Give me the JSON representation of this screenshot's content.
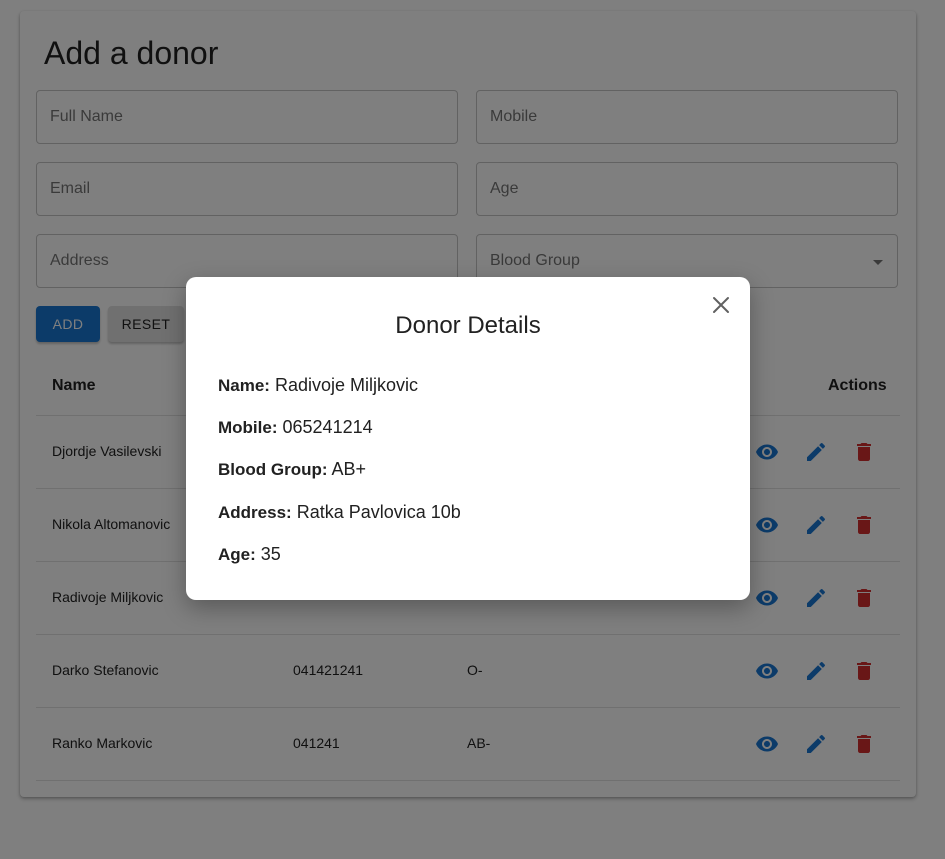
{
  "form": {
    "title": "Add a donor",
    "full_name_placeholder": "Full Name",
    "mobile_placeholder": "Mobile",
    "email_placeholder": "Email",
    "age_placeholder": "Age",
    "address_placeholder": "Address",
    "blood_group_placeholder": "Blood Group",
    "add_label": "ADD",
    "reset_label": "RESET"
  },
  "table": {
    "headers": {
      "name": "Name",
      "actions": "Actions"
    },
    "rows": [
      {
        "name": "Djordje Vasilevski",
        "mobile": "",
        "blood": ""
      },
      {
        "name": "Nikola Altomanovic",
        "mobile": "",
        "blood": ""
      },
      {
        "name": "Radivoje Miljkovic",
        "mobile": "",
        "blood": ""
      },
      {
        "name": "Darko Stefanovic",
        "mobile": "041421241",
        "blood": "O-"
      },
      {
        "name": "Ranko Markovic",
        "mobile": "041241",
        "blood": "AB-"
      }
    ]
  },
  "modal": {
    "title": "Donor Details",
    "fields": [
      {
        "label": "Name:",
        "value": "Radivoje Miljkovic"
      },
      {
        "label": "Mobile:",
        "value": "065241214"
      },
      {
        "label": "Blood Group:",
        "value": "AB+"
      },
      {
        "label": "Address:",
        "value": "Ratka Pavlovica 10b"
      },
      {
        "label": "Age:",
        "value": "35"
      }
    ]
  },
  "icons": {
    "view": "eye-icon",
    "edit": "pencil-icon",
    "delete": "trash-icon",
    "close": "close-icon",
    "select": "chevron-down-icon"
  },
  "colors": {
    "primary": "#1976d2",
    "delete": "#d32f2f",
    "reset_bg": "#e0e0e0"
  }
}
